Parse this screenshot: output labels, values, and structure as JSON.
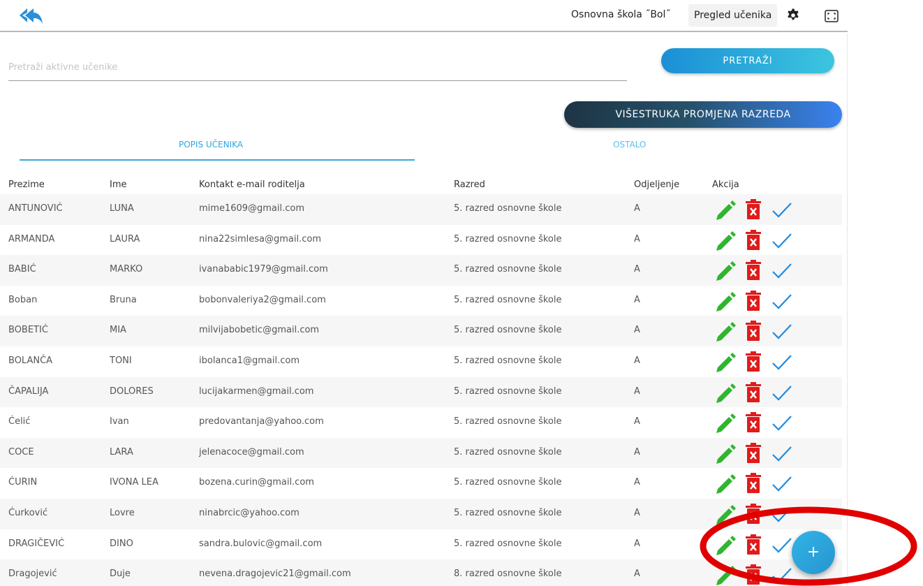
{
  "header": {
    "back_icon": "double-reply-arrow-icon",
    "school_name": "Osnovna škola ˝Bol˝",
    "view_name": "Pregled učenika",
    "settings_icon": "gear-icon",
    "fullscreen_icon": "expand-icon"
  },
  "search": {
    "placeholder": "Pretraži aktivne učenike",
    "value": "",
    "button_label": "PRETRAŽI"
  },
  "multi_change_label": "VIŠESTRUKA PROMJENA RAZREDA",
  "tabs": [
    {
      "label": "POPIS UČENIKA",
      "active": true
    },
    {
      "label": "OSTALO",
      "active": false
    }
  ],
  "table": {
    "columns": [
      "Prezime",
      "Ime",
      "Kontakt e-mail roditelja",
      "Razred",
      "Odjeljenje",
      "Akcija"
    ],
    "rows": [
      {
        "prezime": "ANTUNOVIĆ",
        "ime": "LUNA",
        "email": "mime1609@gmail.com",
        "razred": "5. razred osnovne škole",
        "odjeljenje": "A"
      },
      {
        "prezime": "ARMANDA",
        "ime": "LAURA",
        "email": "nina22simlesa@gmail.com",
        "razred": "5. razred osnovne škole",
        "odjeljenje": "A"
      },
      {
        "prezime": "BABIĆ",
        "ime": "MARKO",
        "email": "ivanababic1979@gmail.com",
        "razred": "5. razred osnovne škole",
        "odjeljenje": "A"
      },
      {
        "prezime": "Boban",
        "ime": "Bruna",
        "email": "bobonvaleriya2@gmail.com",
        "razred": "5. razred osnovne škole",
        "odjeljenje": "A"
      },
      {
        "prezime": "BOBETIĆ",
        "ime": "MIA",
        "email": "milvijabobetic@gmail.com",
        "razred": "5. razred osnovne škole",
        "odjeljenje": "A"
      },
      {
        "prezime": "BOLANČA",
        "ime": "TONI",
        "email": "ibolanca1@gmail.com",
        "razred": "5. razred osnovne škole",
        "odjeljenje": "A"
      },
      {
        "prezime": "ČAPALIJA",
        "ime": "DOLORES",
        "email": "lucijakarmen@gmail.com",
        "razred": "5. razred osnovne škole",
        "odjeljenje": "A"
      },
      {
        "prezime": "Ćelić",
        "ime": "Ivan",
        "email": "predovantanja@yahoo.com",
        "razred": "5. razred osnovne škole",
        "odjeljenje": "A"
      },
      {
        "prezime": "COCE",
        "ime": "LARA",
        "email": "jelenacoce@gmail.com",
        "razred": "5. razred osnovne škole",
        "odjeljenje": "A"
      },
      {
        "prezime": "ĆURIN",
        "ime": "IVONA LEA",
        "email": "bozena.curin@gmail.com",
        "razred": "5. razred osnovne škole",
        "odjeljenje": "A"
      },
      {
        "prezime": "Ćurković",
        "ime": "Lovre",
        "email": "ninabrcic@yahoo.com",
        "razred": "5. razred osnovne škole",
        "odjeljenje": "A"
      },
      {
        "prezime": "DRAGIČEVIĆ",
        "ime": "DINO",
        "email": "sandra.bulovic@gmail.com",
        "razred": "5. razred osnovne škole",
        "odjeljenje": "A"
      },
      {
        "prezime": "Dragojević",
        "ime": "Duje",
        "email": "nevena.dragojevic21@gmail.com",
        "razred": "8. razred osnovne škole",
        "odjeljenje": "A"
      }
    ],
    "action_icons": [
      "pencil-icon",
      "trash-icon",
      "check-icon"
    ]
  },
  "fab": {
    "label": "+",
    "icon": "plus-icon"
  },
  "colors": {
    "accent": "#2da6df",
    "edit": "#2fb52f",
    "delete": "#e01b1b",
    "check": "#1f8be0",
    "highlight": "#e00000"
  }
}
